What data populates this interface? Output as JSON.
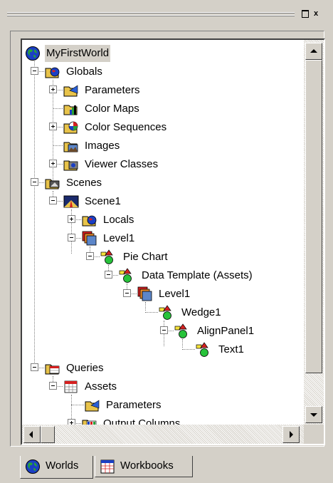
{
  "window": {
    "maximize_button": "□",
    "close_button": "x"
  },
  "tree": {
    "nodes": [
      {
        "label": "MyFirstWorld",
        "icon": "globe-icon"
      },
      {
        "label": "Globals",
        "icon": "folder-icon"
      },
      {
        "label": "Parameters",
        "icon": "folder-icon"
      },
      {
        "label": "Color Maps",
        "icon": "color-map-icon"
      },
      {
        "label": "Color Sequences",
        "icon": "folder-icon"
      },
      {
        "label": "Images",
        "icon": "image-icon"
      },
      {
        "label": "Viewer Classes",
        "icon": "folder-icon"
      },
      {
        "label": "Scenes",
        "icon": "folder-icon"
      },
      {
        "label": "Scene1",
        "icon": "scene-icon"
      },
      {
        "label": "Locals",
        "icon": "folder-icon"
      },
      {
        "label": "Level1",
        "icon": "level-icon"
      },
      {
        "label": "Pie Chart",
        "icon": "object-icon"
      },
      {
        "label": "Data Template (Assets)",
        "icon": "object-icon"
      },
      {
        "label": "Level1",
        "icon": "level-icon"
      },
      {
        "label": "Wedge1",
        "icon": "object-icon"
      },
      {
        "label": "AlignPanel1",
        "icon": "object-icon"
      },
      {
        "label": "Text1",
        "icon": "object-icon"
      },
      {
        "label": "Queries",
        "icon": "folder-icon"
      },
      {
        "label": "Assets",
        "icon": "table-icon"
      },
      {
        "label": "Parameters",
        "icon": "folder-icon"
      },
      {
        "label": "Output Columns",
        "icon": "columns-icon"
      }
    ]
  },
  "tabs": [
    {
      "label": "Worlds",
      "icon": "globe-icon",
      "active": true
    },
    {
      "label": "Workbooks",
      "icon": "workbook-icon",
      "active": false
    }
  ],
  "colors": {
    "chrome": "#d4d0c8",
    "tree_bg": "#ffffff"
  }
}
